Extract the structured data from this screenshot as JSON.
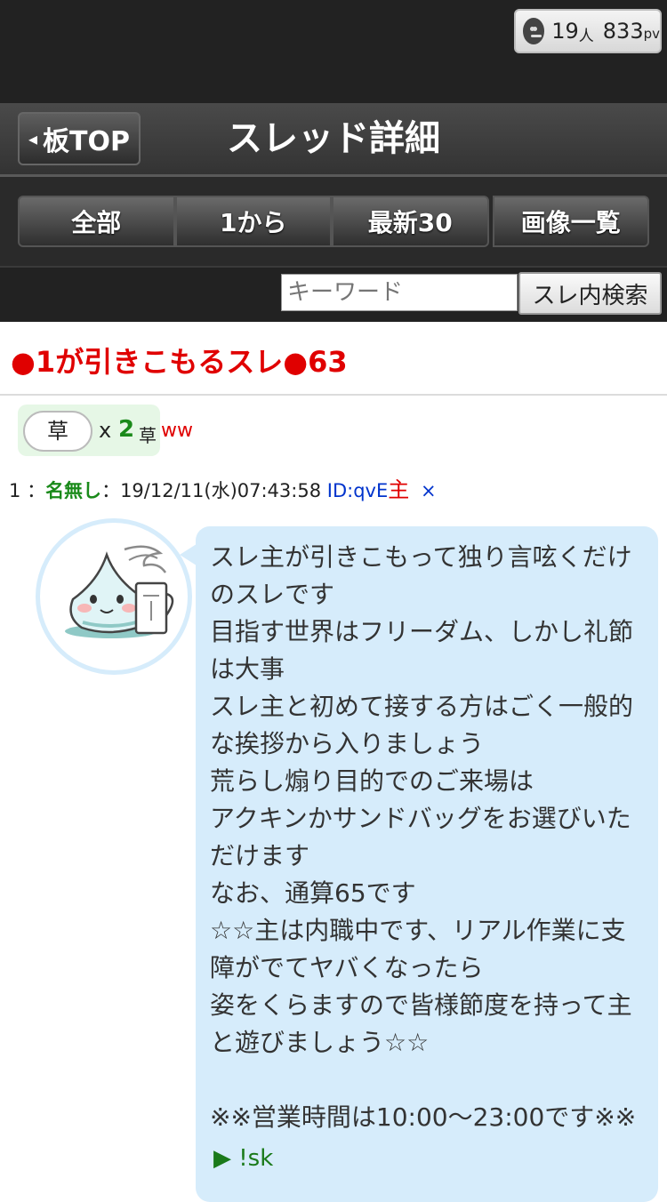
{
  "header": {
    "counter_people": "19",
    "counter_people_unit": "人",
    "counter_pv": "833",
    "counter_pv_unit": "pv",
    "back_label": "板TOP",
    "title": "スレッド詳細"
  },
  "tabs": [
    "全部",
    "1から",
    "最新30",
    "画像一覧"
  ],
  "search": {
    "placeholder": "キーワード",
    "button_label": "スレ内検索"
  },
  "thread": {
    "title": "●1が引きこもるスレ●63"
  },
  "reactions": {
    "chip_label": "草",
    "multiplier": "x",
    "count": "2",
    "kusa_label": "草",
    "ww_label": "ww"
  },
  "post": {
    "number": "1",
    "separator": "：",
    "name": "名無し",
    "date": "19/12/11(水)07:43:58",
    "id": "ID:qvE",
    "owner_mark": "主",
    "delete_mark": "×",
    "body": "スレ主が引きこもって独り言呟くだけのスレです\n目指す世界はフリーダム、しかし礼節は大事\nスレ主と初めて接する方はごく一般的な挨拶から入りましょう\n荒らし煽り目的でのご来場は\nアクキンかサンドバッグをお選びいただけます\nなお、通算65です\n☆☆主は内職中です、リアル作業に支障がでてヤバくなったら\n姿をくらますので皆様節度を持って主と遊びましょう☆☆\n\n※※営業時間は10:00～23:00です※※",
    "sk_label": "▶ !sk"
  }
}
